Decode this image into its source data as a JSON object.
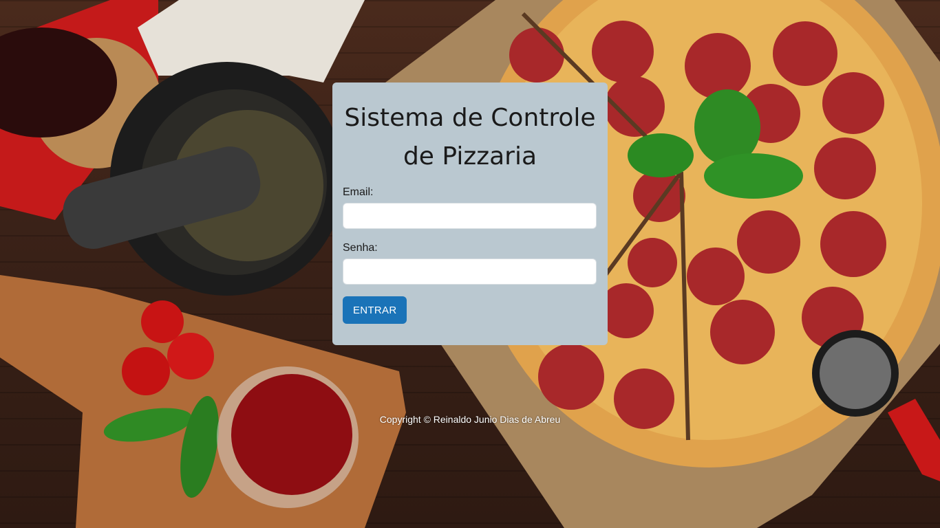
{
  "login": {
    "title": "Sistema de Controle de Pizzaria",
    "email_label": "Email:",
    "email_value": "",
    "password_label": "Senha:",
    "password_value": "",
    "submit_label": "ENTRAR"
  },
  "footer": {
    "copyright": "Copyright © Reinaldo Junio Dias de Abreu"
  },
  "colors": {
    "card_background": "#bac8d0",
    "button_background": "#1a73b8",
    "wood_background": "#3b2218"
  },
  "background": {
    "icon": "pizza-photo"
  }
}
